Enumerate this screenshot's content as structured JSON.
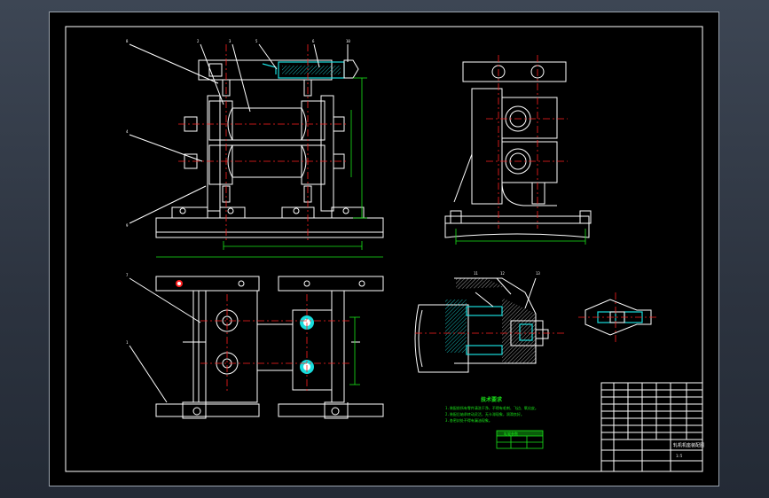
{
  "colors": {
    "background": "#2c333f",
    "sheet": "#000000",
    "outline": "#ffffff",
    "centerline": "#ff2020",
    "dimension": "#19e619",
    "section": "#19dcdc"
  },
  "drawing": {
    "views": [
      "front-view",
      "side-view",
      "top-view",
      "section-detail",
      "small-detail"
    ],
    "balloons_front": [
      "8",
      "2",
      "3",
      "5",
      "6",
      "10",
      "4",
      "9"
    ],
    "balloons_top": [
      "7",
      "1"
    ],
    "balloons_section": [
      "11",
      "12",
      "13"
    ],
    "notes_title": "技术要求",
    "notes_lines": [
      "1.装配前所有零件清洗干净，不得有毛刺、飞边、氧化皮。",
      "2.装配后轴承转动灵活，无卡滞现象，润滑良好。",
      "3.各密封处不得有漏油现象。"
    ],
    "green_table_header": "轧辊参数",
    "title_block": {
      "title": "轧机机座装配图",
      "scale_label": "1:5"
    }
  }
}
